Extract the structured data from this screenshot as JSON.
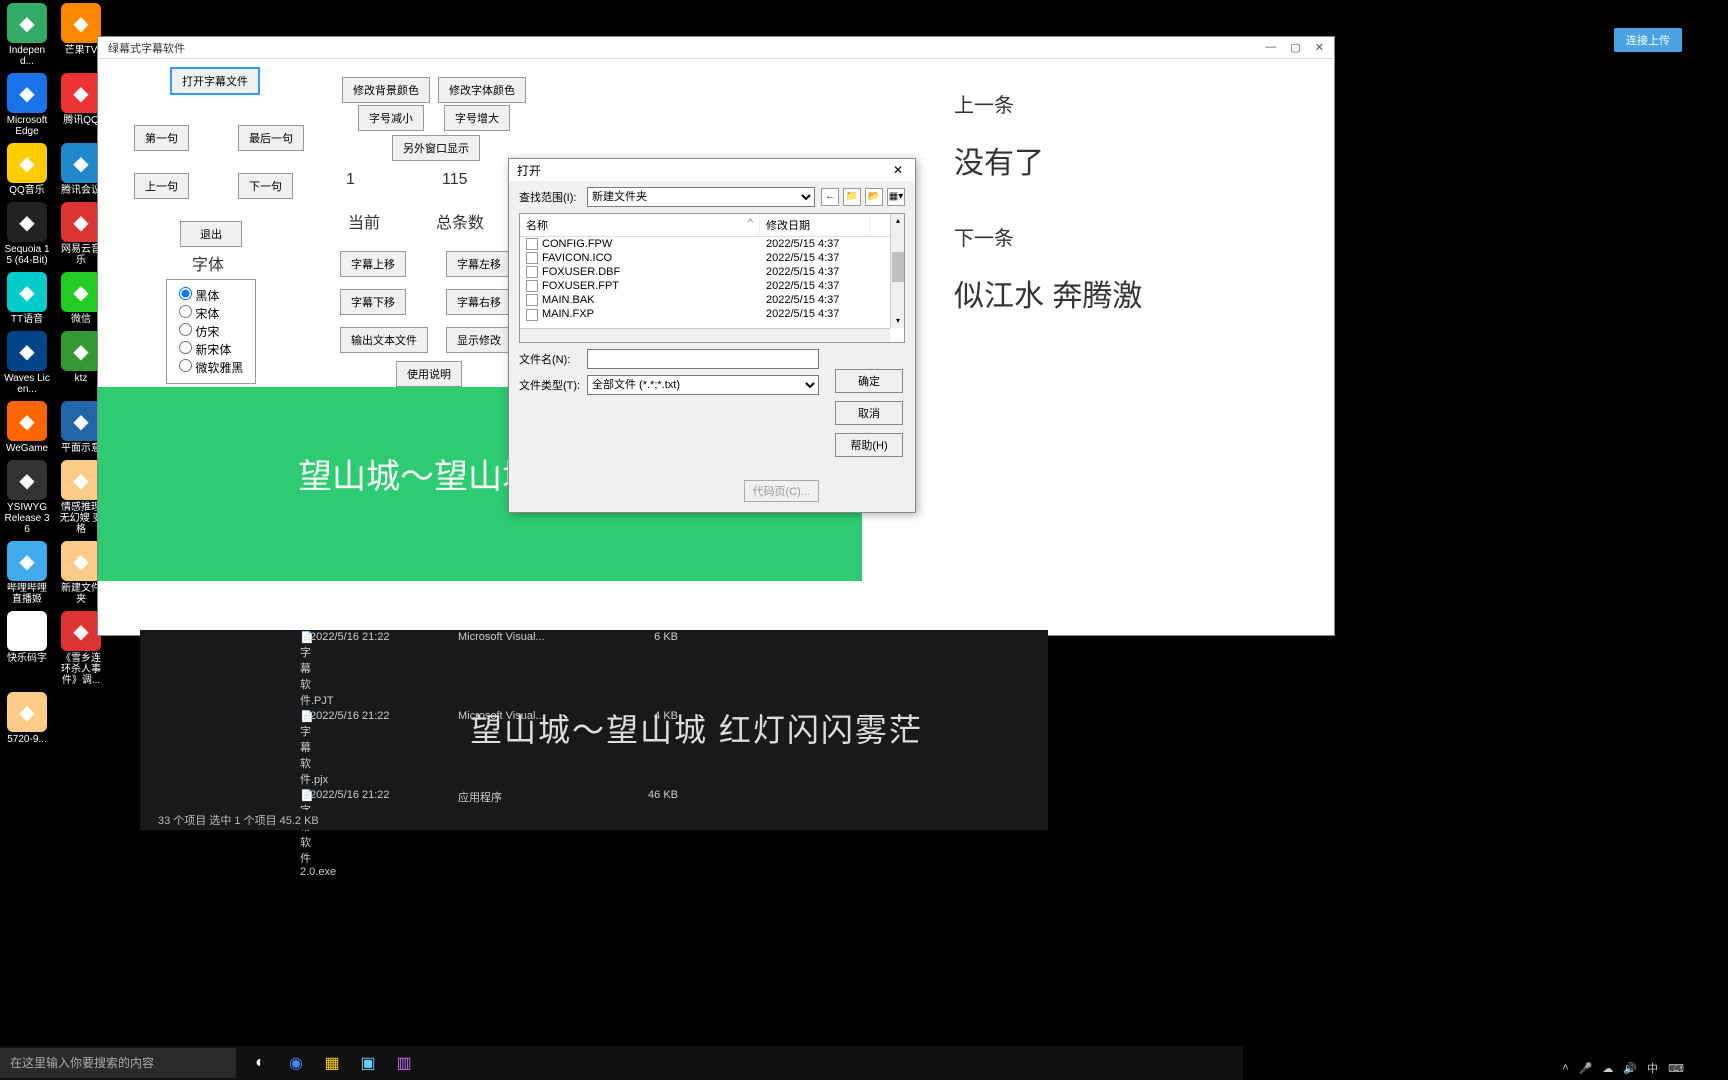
{
  "desktop_icons": [
    {
      "label": "Independ...",
      "color": "#3a6"
    },
    {
      "label": "芒果TV",
      "color": "#f80"
    },
    {
      "label": "Microsoft Edge",
      "color": "#1a73e8"
    },
    {
      "label": "腾讯QQ",
      "color": "#e33"
    },
    {
      "label": "QQ音乐",
      "color": "#fc0"
    },
    {
      "label": "腾讯会议",
      "color": "#28c"
    },
    {
      "label": "Sequoia 15 (64-Bit)",
      "color": "#222"
    },
    {
      "label": "网易云音乐",
      "color": "#d33"
    },
    {
      "label": "TT语音",
      "color": "#0cc"
    },
    {
      "label": "微信",
      "color": "#2c2"
    },
    {
      "label": "Waves Licen...",
      "color": "#048"
    },
    {
      "label": "ktz",
      "color": "#393"
    },
    {
      "label": "WeGame",
      "color": "#f60"
    },
    {
      "label": "平面示意",
      "color": "#26a"
    },
    {
      "label": "YSIWYG Release 36",
      "color": "#333"
    },
    {
      "label": "情感推理无幻嫂 变格",
      "color": "#fc8"
    },
    {
      "label": "哔哩哔哩直播姬",
      "color": "#4ae"
    },
    {
      "label": "新建文件夹",
      "color": "#fc8"
    },
    {
      "label": "快乐码字",
      "color": "#fff"
    },
    {
      "label": "《雪乡连环杀人事件》调...",
      "color": "#d33"
    },
    {
      "label": "5720-9...",
      "color": "#fc8"
    }
  ],
  "app": {
    "title": "绿幕式字幕软件",
    "buttons": {
      "open_subtitle": "打开字幕文件",
      "bg_color": "修改背景颜色",
      "font_color": "修改字体颜色",
      "font_smaller": "字号减小",
      "font_bigger": "字号增大",
      "first": "第一句",
      "last": "最后一句",
      "ext_window": "另外窗口显示",
      "prev": "上一句",
      "next": "下一句",
      "exit": "退出",
      "sub_up": "字幕上移",
      "sub_left": "字幕左移",
      "sub_down": "字幕下移",
      "sub_right": "字幕右移",
      "export_text": "输出文本文件",
      "show_edit": "显示修改",
      "instructions": "使用说明"
    },
    "labels": {
      "current": "当前",
      "total": "总条数",
      "font": "字体",
      "current_val": "1",
      "total_val": "115"
    },
    "fonts": [
      "黑体",
      "宋体",
      "仿宋",
      "新宋体",
      "微软雅黑"
    ],
    "preview_text": "望山城～望山城",
    "side": {
      "prev_label": "上一条",
      "prev_text": "没有了",
      "next_label": "下一条",
      "next_text": "似江水  奔腾激"
    }
  },
  "dialog": {
    "title": "打开",
    "range_label": "查找范围(I):",
    "folder": "新建文件夹",
    "col_name": "名称",
    "col_date": "修改日期",
    "files": [
      {
        "name": "CONFIG.FPW",
        "date": "2022/5/15 4:37"
      },
      {
        "name": "FAVICON.ICO",
        "date": "2022/5/15 4:37"
      },
      {
        "name": "FOXUSER.DBF",
        "date": "2022/5/15 4:37"
      },
      {
        "name": "FOXUSER.FPT",
        "date": "2022/5/15 4:37"
      },
      {
        "name": "MAIN.BAK",
        "date": "2022/5/15 4:37"
      },
      {
        "name": "MAIN.FXP",
        "date": "2022/5/15 4:37"
      }
    ],
    "filename_label": "文件名(N):",
    "filetype_label": "文件类型(T):",
    "filetype_value": "全部文件 (*.*;*.txt)",
    "ok": "确定",
    "cancel": "取消",
    "help": "帮助(H)",
    "codepage": "代码页(C)..."
  },
  "explorer": {
    "rows": [
      {
        "name": "字幕软件.PJT",
        "date": "2022/5/16 21:22",
        "type": "Microsoft Visual...",
        "size": "6 KB"
      },
      {
        "name": "字幕软件.pjx",
        "date": "2022/5/16 21:22",
        "type": "Microsoft Visual...",
        "size": "4 KB"
      },
      {
        "name": "字幕软件2.0.exe",
        "date": "2022/5/16 21:22",
        "type": "应用程序",
        "size": "46 KB"
      }
    ],
    "status": "33 个项目    选中 1 个项目  45.2 KB"
  },
  "subtitle_overlay": "望山城～望山城  红灯闪闪雾茫",
  "taskbar": {
    "search_placeholder": "在这里输入你要搜索的内容"
  },
  "upload_badge": "连接上传",
  "systray": {
    "ime": "中",
    "kb": "⌨"
  }
}
